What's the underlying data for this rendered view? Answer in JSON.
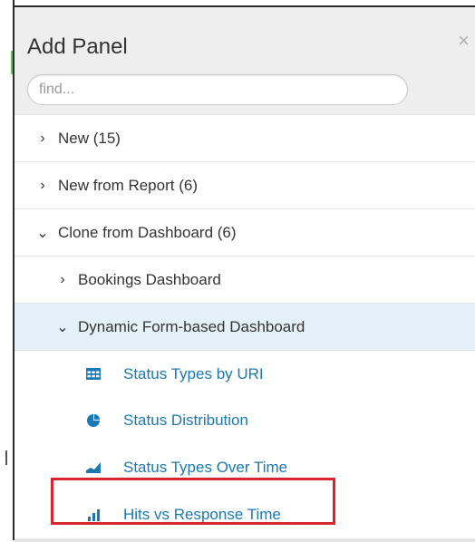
{
  "header": {
    "title": "Add Panel",
    "close_icon": "×"
  },
  "search": {
    "placeholder": "find..."
  },
  "tree": {
    "new": "New (15)",
    "new_from_report": "New from Report (6)",
    "clone_from_dashboard": "Clone from Dashboard (6)",
    "bookings": "Bookings Dashboard",
    "dynamic": "Dynamic Form-based Dashboard",
    "items": [
      {
        "label": "Status Types by URI",
        "icon": "table-icon"
      },
      {
        "label": "Status Distribution",
        "icon": "pie-chart-icon"
      },
      {
        "label": "Status Types Over Time",
        "icon": "area-chart-icon"
      },
      {
        "label": "Hits vs Response Time",
        "icon": "column-chart-icon"
      }
    ]
  },
  "colors": {
    "accent": "#1a78b4",
    "selected_bg": "#e5f1f9",
    "highlight": "#d9262e"
  }
}
